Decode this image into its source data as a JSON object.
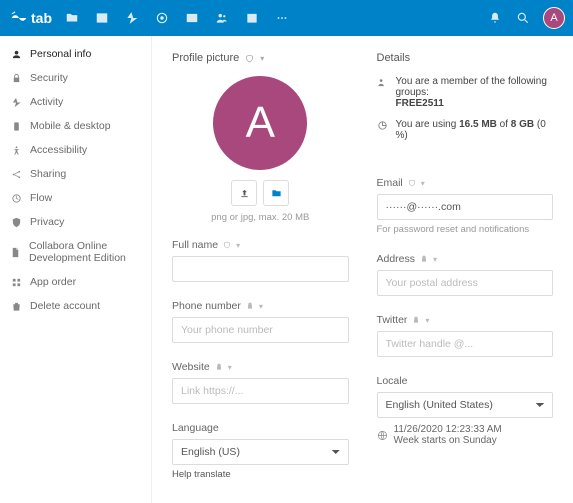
{
  "brand": "tab",
  "avatar_initial": "A",
  "sidebar": {
    "items": [
      {
        "label": "Personal info"
      },
      {
        "label": "Security"
      },
      {
        "label": "Activity"
      },
      {
        "label": "Mobile & desktop"
      },
      {
        "label": "Accessibility"
      },
      {
        "label": "Sharing"
      },
      {
        "label": "Flow"
      },
      {
        "label": "Privacy"
      },
      {
        "label": "Collabora Online Development Edition"
      },
      {
        "label": "App order"
      },
      {
        "label": "Delete account"
      }
    ]
  },
  "profile": {
    "title": "Profile picture",
    "hint": "png or jpg, max. 20 MB",
    "full_name_label": "Full name",
    "full_name_value": "",
    "phone_label": "Phone number",
    "phone_placeholder": "Your phone number",
    "phone_value": "",
    "website_label": "Website",
    "website_placeholder": "Link https://...",
    "website_value": "",
    "language_label": "Language",
    "language_value": "English (US)",
    "help_translate": "Help translate"
  },
  "details": {
    "title": "Details",
    "groups_text": "You are a member of the following groups:",
    "groups_value": "FREE2511",
    "usage_prefix": "You are using ",
    "usage_used": "16.5 MB",
    "usage_of": " of ",
    "usage_total": "8 GB",
    "usage_pct": " (0 %)",
    "email_label": "Email",
    "email_value": "······@······.com",
    "email_hint": "For password reset and notifications",
    "address_label": "Address",
    "address_placeholder": "Your postal address",
    "address_value": "",
    "twitter_label": "Twitter",
    "twitter_placeholder": "Twitter handle @...",
    "twitter_value": "",
    "locale_label": "Locale",
    "locale_value": "English (United States)",
    "locale_date": "11/26/2020 12:23:33 AM",
    "locale_week": "Week starts on Sunday"
  }
}
